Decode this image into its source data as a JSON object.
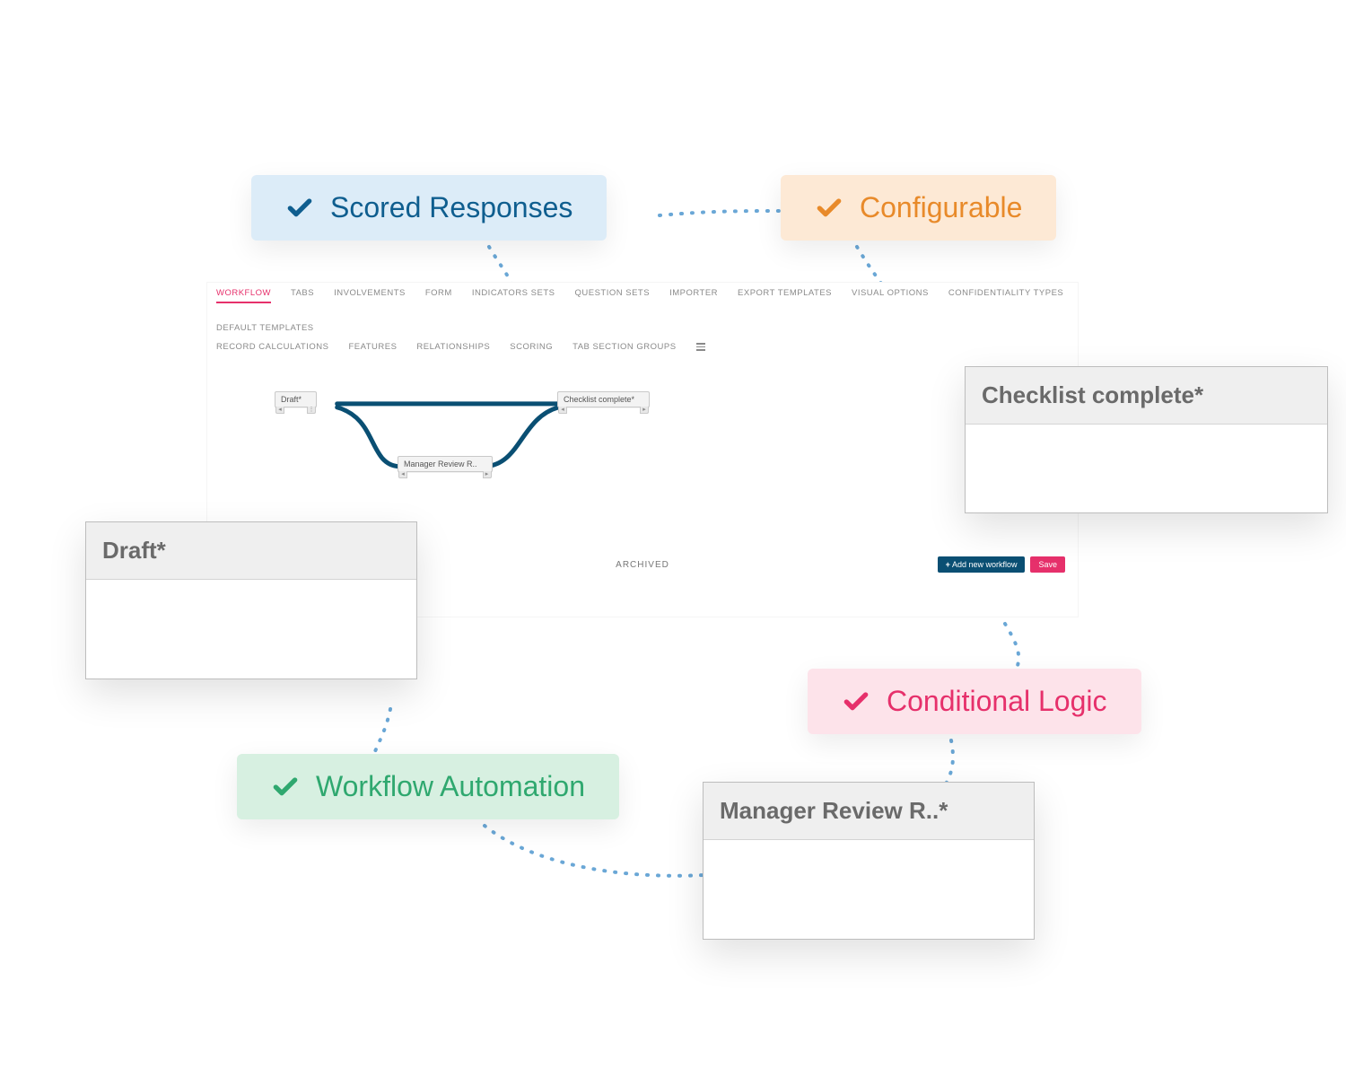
{
  "tabs_row1": [
    "WORKFLOW",
    "TABS",
    "INVOLVEMENTS",
    "FORM",
    "INDICATORS SETS",
    "QUESTION SETS",
    "IMPORTER",
    "EXPORT TEMPLATES",
    "VISUAL OPTIONS",
    "CONFIDENTIALITY TYPES",
    "DEFAULT TEMPLATES"
  ],
  "tabs_row2": [
    "RECORD CALCULATIONS",
    "FEATURES",
    "RELATIONSHIPS",
    "SCORING",
    "TAB SECTION GROUPS"
  ],
  "active_tab": "WORKFLOW",
  "nodes": {
    "draft": "Draft*",
    "checklist": "Checklist complete*",
    "manager": "Manager Review R.."
  },
  "archived_label": "ARCHIVED",
  "buttons": {
    "add": "Add new workflow",
    "save": "Save"
  },
  "chips": {
    "scored": "Scored Responses",
    "configurable": "Configurable",
    "workflow": "Workflow Automation",
    "conditional": "Conditional Logic"
  },
  "cards": {
    "draft": "Draft*",
    "checklist": "Checklist complete*",
    "manager": "Manager Review R..*"
  }
}
